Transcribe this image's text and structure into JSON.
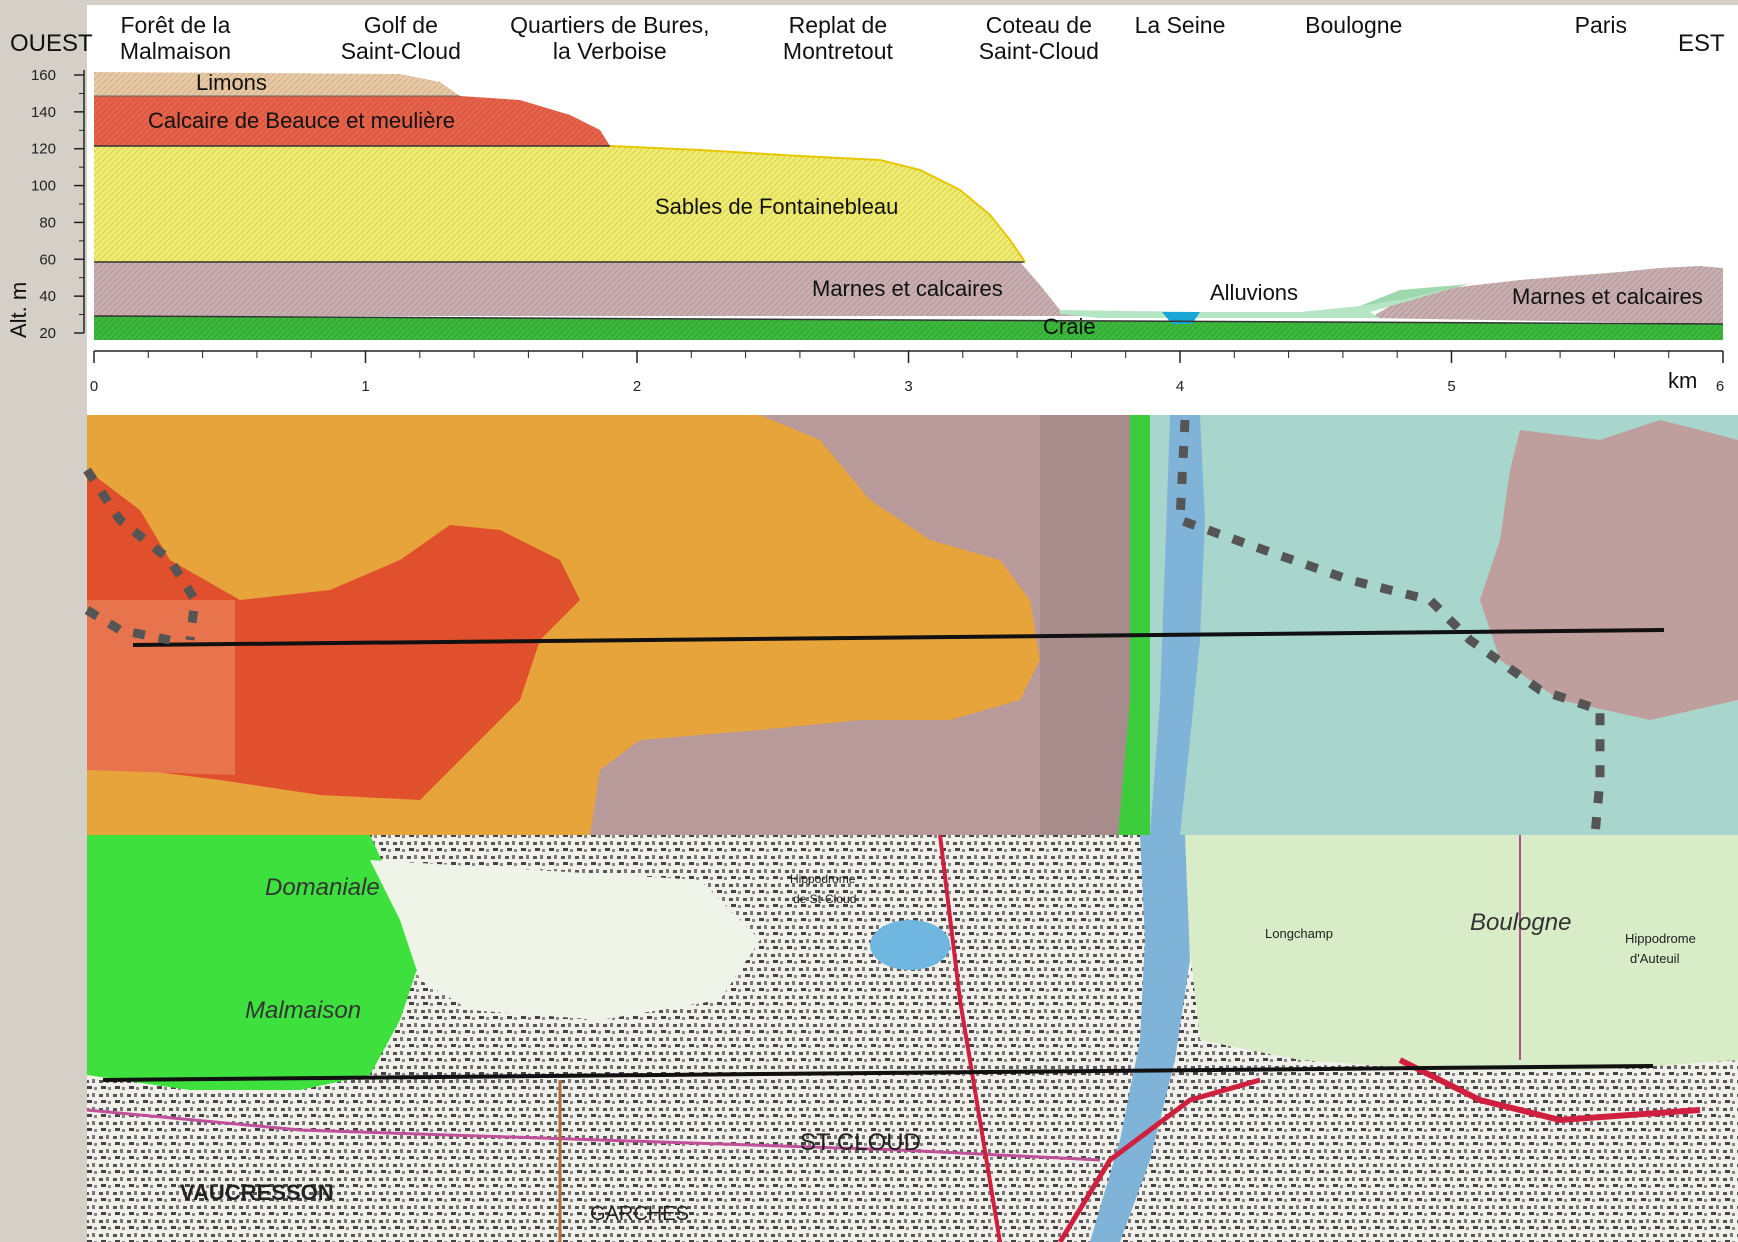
{
  "directions": {
    "west": "OUEST",
    "east": "EST"
  },
  "y_axis": {
    "label": "Alt. m",
    "ticks": [
      "160",
      "140",
      "120",
      "100",
      "80",
      "60",
      "40",
      "20"
    ],
    "values": [
      160,
      140,
      120,
      100,
      80,
      60,
      40,
      20
    ]
  },
  "x_axis": {
    "unit": "km",
    "ticks": [
      "0",
      "1",
      "2",
      "3",
      "4",
      "5",
      "6"
    ],
    "values": [
      0,
      1,
      2,
      3,
      4,
      5,
      6
    ]
  },
  "places": [
    {
      "text": "Forêt de la\nMalmaison",
      "km": 0.3
    },
    {
      "text": "Golf de\nSaint-Cloud",
      "km": 1.13
    },
    {
      "text": "Quartiers de Bures,\nla Verboise",
      "km": 1.9
    },
    {
      "text": "Replat de\nMontretout",
      "km": 2.74
    },
    {
      "text": "Coteau de\nSaint-Cloud",
      "km": 3.48
    },
    {
      "text": "La Seine",
      "km": 4.0
    },
    {
      "text": "Boulogne",
      "km": 4.64
    },
    {
      "text": "Paris",
      "km": 5.55
    }
  ],
  "layers": {
    "limons": "Limons",
    "calcaire": "Calcaire de Beauce et meulière",
    "sables": "Sables de Fontainebleau",
    "marnes_w": "Marnes et calcaires",
    "alluvions": "Alluvions",
    "marnes_e": "Marnes et calcaires",
    "craie": "Craie"
  },
  "colors": {
    "limons": "#e8c9a4",
    "calcaire": "#e8624a",
    "sables": "#f0ec6e",
    "marnes": "#c9aeb0",
    "craie": "#3cb83c",
    "alluvions": "#b5e6c4",
    "seine": "#1aa6d6",
    "panel": "#d4d0c8",
    "geo_orange": "#e7a43a",
    "geo_red": "#e0502c",
    "geo_pink": "#b89a9a",
    "geo_teal": "#a9d6cc",
    "map_green": "#3ee03e"
  },
  "map_labels": {
    "forest": "Domaniale",
    "forest2": "Malmaison",
    "vaucresson": "VAUCRESSON",
    "garches": "GARCHES",
    "stcloud": "ST CLOUD",
    "hippodrome": "Hippodrome",
    "hippodrome2": "de St-Cloud",
    "longchamp": "Longchamp",
    "boulogne": "Boulogne",
    "auteuil": "Hippodrome",
    "auteuil2": "d'Auteuil"
  }
}
